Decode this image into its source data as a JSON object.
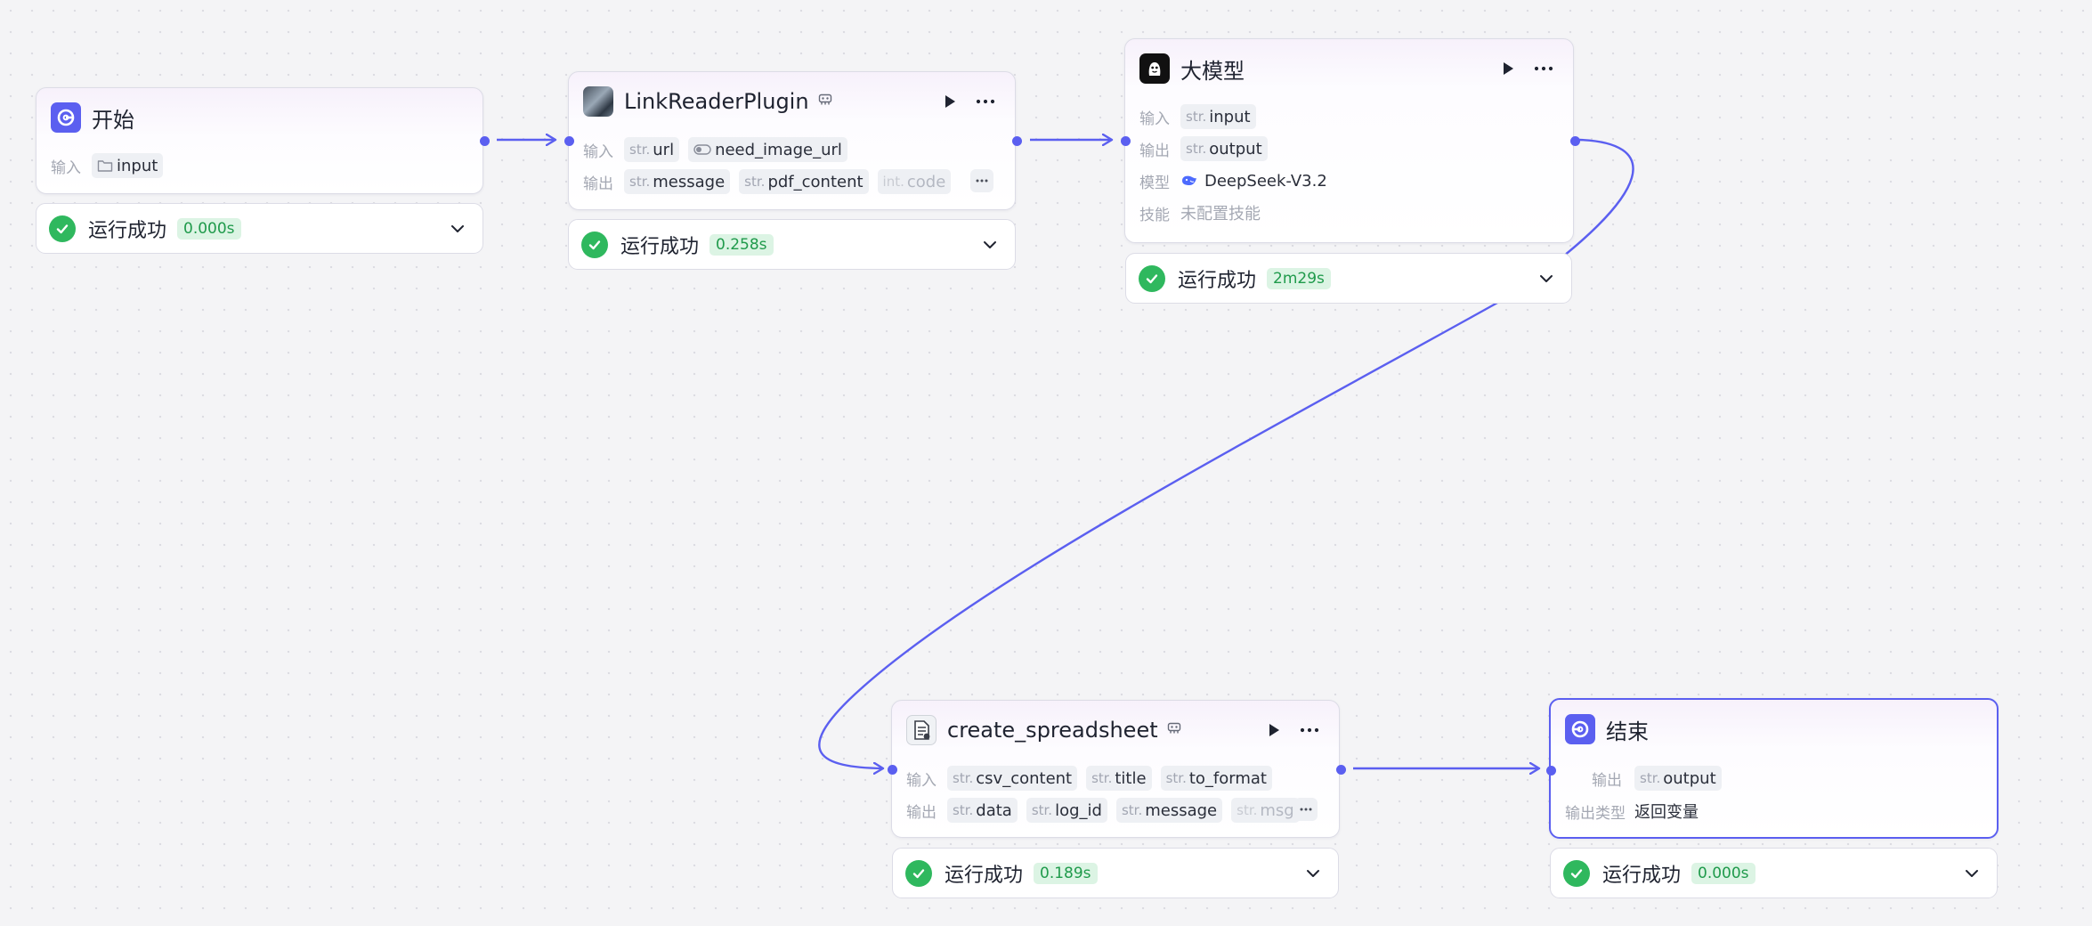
{
  "labels": {
    "input": "输入",
    "output": "输出",
    "model": "模型",
    "skills": "技能",
    "output_type": "输出类型"
  },
  "type_prefixes": {
    "str": "str.",
    "int": "int."
  },
  "status_text": "运行成功",
  "nodes": {
    "start": {
      "title": "开始",
      "icon": "start-node-icon",
      "inputs": [
        {
          "name": "input",
          "type_icon": "folder-icon"
        }
      ],
      "status": {
        "text": "运行成功",
        "time": "0.000s"
      }
    },
    "link_reader": {
      "title": "LinkReaderPlugin",
      "icon": "plugin-avatar-icon",
      "inputs": [
        {
          "type": "str.",
          "name": "url"
        },
        {
          "type_icon": "toggle-icon",
          "name": "need_image_url"
        }
      ],
      "outputs": [
        {
          "type": "str.",
          "name": "message"
        },
        {
          "type": "str.",
          "name": "pdf_content"
        },
        {
          "type": "int.",
          "name": "code"
        }
      ],
      "status": {
        "text": "运行成功",
        "time": "0.258s"
      }
    },
    "llm": {
      "title": "大模型",
      "icon": "llm-avatar-icon",
      "inputs": [
        {
          "type": "str.",
          "name": "input"
        }
      ],
      "outputs": [
        {
          "type": "str.",
          "name": "output"
        }
      ],
      "model": "DeepSeek-V3.2",
      "skills": "未配置技能",
      "status": {
        "text": "运行成功",
        "time": "2m29s"
      }
    },
    "create_spreadsheet": {
      "title": "create_spreadsheet",
      "icon": "spreadsheet-avatar-icon",
      "inputs": [
        {
          "type": "str.",
          "name": "csv_content"
        },
        {
          "type": "str.",
          "name": "title"
        },
        {
          "type": "str.",
          "name": "to_format"
        }
      ],
      "outputs": [
        {
          "type": "str.",
          "name": "data"
        },
        {
          "type": "str.",
          "name": "log_id"
        },
        {
          "type": "str.",
          "name": "message"
        },
        {
          "type": "str.",
          "name": "msg"
        }
      ],
      "status": {
        "text": "运行成功",
        "time": "0.189s"
      }
    },
    "end": {
      "title": "结束",
      "icon": "end-node-icon",
      "outputs": [
        {
          "type": "str.",
          "name": "output"
        }
      ],
      "output_type": "返回变量",
      "status": {
        "text": "运行成功",
        "time": "0.000s"
      }
    }
  },
  "colors": {
    "accent": "#5b5ff0",
    "success": "#2fb85e",
    "success_bg": "#dcf4e4",
    "tag_bg": "#eef0f4",
    "muted": "#a4a8b3"
  }
}
